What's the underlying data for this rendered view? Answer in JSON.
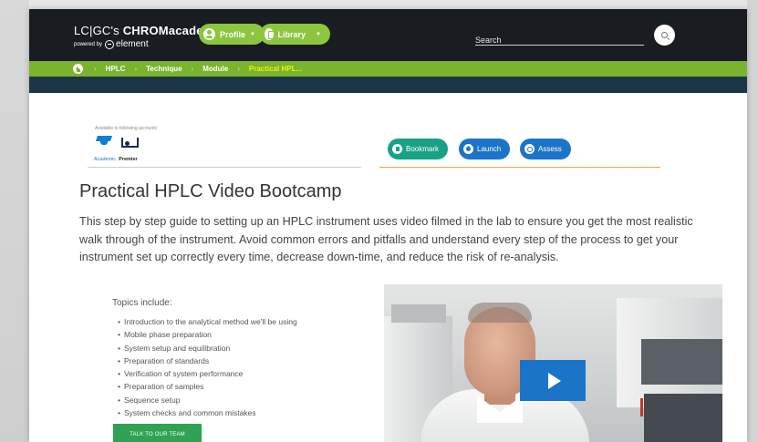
{
  "header": {
    "logo": {
      "prefix": "LC|GC's",
      "brand": "CHROMacademy",
      "powered_by": "powered by",
      "partner": "element"
    },
    "profile_label": "Profile",
    "library_label": "Library",
    "search": {
      "placeholder": "Search",
      "value": ""
    }
  },
  "breadcrumb": [
    "HPLC",
    "Technique",
    "Module",
    "Practical HPL..."
  ],
  "accounts": {
    "label": "Available to following accounts",
    "names": [
      "Academic",
      "Premier"
    ]
  },
  "actions": {
    "bookmark": "Bookmark",
    "launch": "Launch",
    "assess": "Assess"
  },
  "page": {
    "title": "Practical HPLC Video Bootcamp",
    "description": "This step by step guide to setting up an HPLC instrument uses video filmed in the lab to ensure you get the most realistic walk through of the instrument. Avoid common errors and pitfalls and understand every step of the process to get your instrument set up correctly every time, decrease down-time, and reduce the risk of re-analysis.",
    "topics_heading": "Topics include:",
    "topics": [
      "Introduction to the analytical method we'll be using",
      "Mobile phase preparation",
      "System setup and equilibration",
      "Preparation of standards",
      "Verification of system performance",
      "Preparation of samples",
      "Sequence setup",
      "System checks and common mistakes"
    ],
    "cta": "TALK TO OUR TEAM"
  },
  "colors": {
    "header_bg": "#191c20",
    "accent_green": "#8cc63f",
    "breadcrumb_bg": "#7ab32e",
    "breadcrumb_current": "#eaf30b",
    "nav_strip": "#1c3645",
    "bookmark": "#19a186",
    "blue": "#1c74c9",
    "cta_green": "#2fa253",
    "orange_rule": "#f0a34a"
  },
  "icons": {
    "home": "home-icon",
    "profile": "user-icon",
    "library": "book-icon",
    "search": "search-icon",
    "academic": "graduation-cap-icon",
    "premier": "crown-icon",
    "bookmark": "bookmark-icon",
    "launch": "rocket-icon",
    "assess": "target-icon",
    "play": "play-icon"
  }
}
